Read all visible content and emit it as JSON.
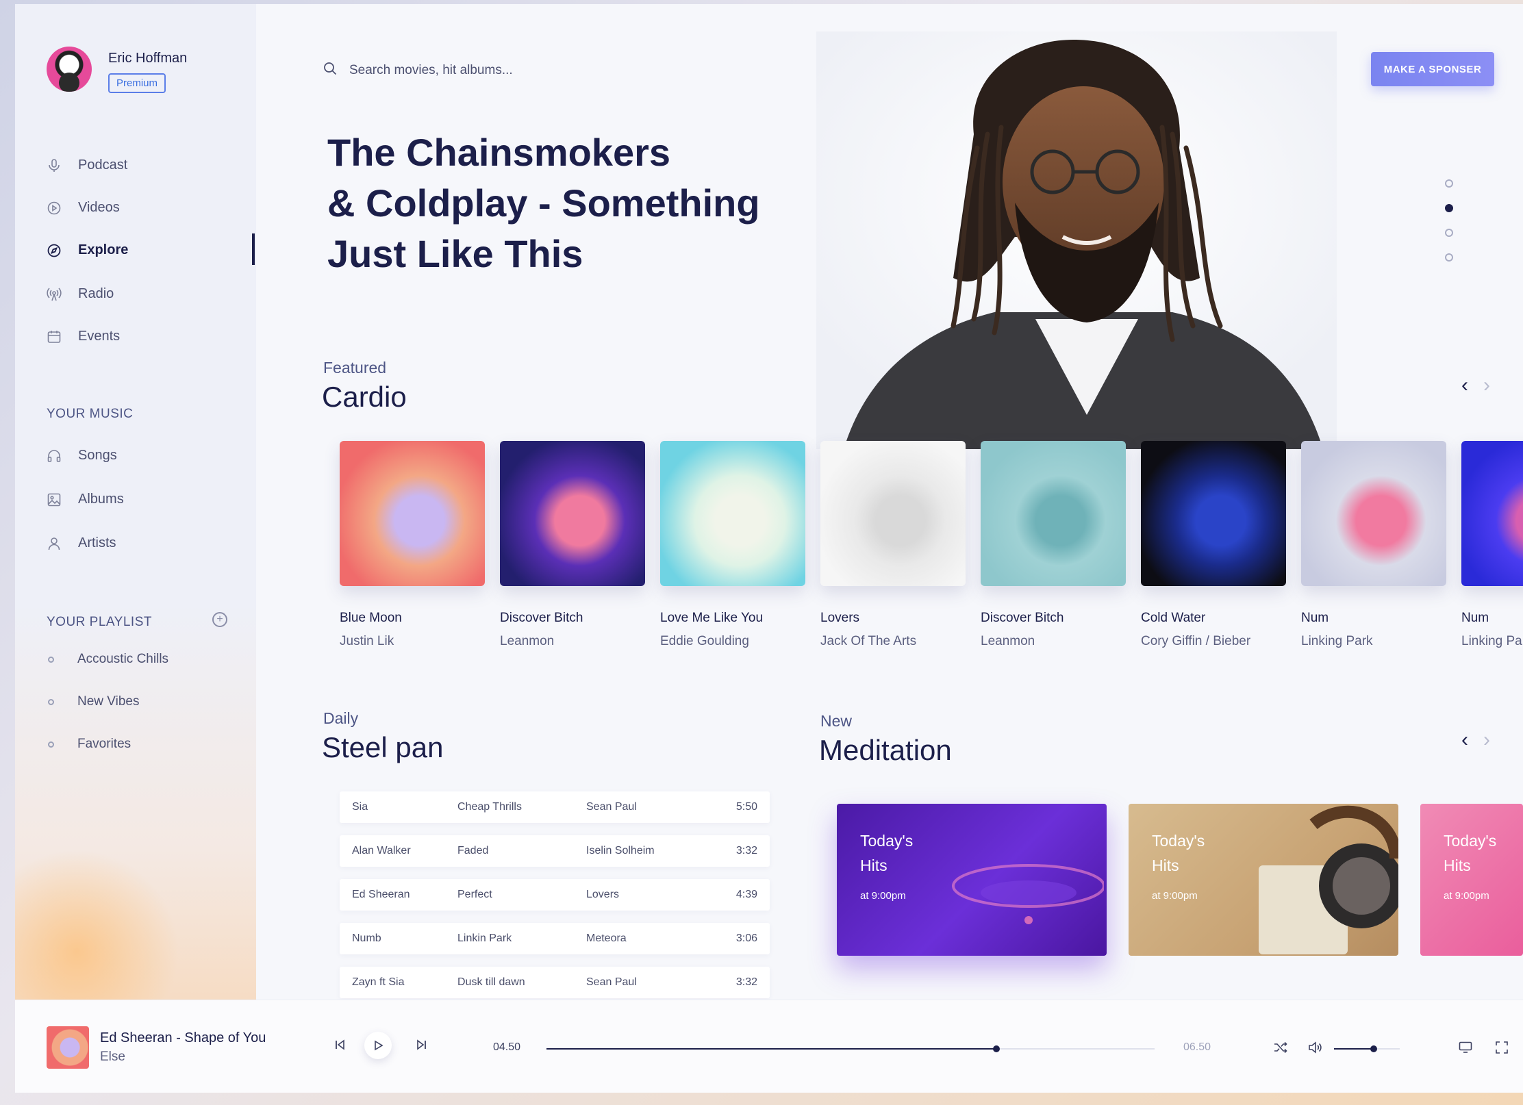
{
  "profile": {
    "name": "Eric Hoffman",
    "badge": "Premium"
  },
  "nav": [
    {
      "label": "Podcast",
      "icon": "mic-icon"
    },
    {
      "label": "Videos",
      "icon": "play-circle-icon"
    },
    {
      "label": "Explore",
      "icon": "compass-icon",
      "active": true
    },
    {
      "label": "Radio",
      "icon": "radio-icon"
    },
    {
      "label": "Events",
      "icon": "calendar-icon"
    }
  ],
  "your_music": {
    "heading": "YOUR MUSIC",
    "items": [
      {
        "label": "Songs",
        "icon": "headphones-icon"
      },
      {
        "label": "Albums",
        "icon": "image-icon"
      },
      {
        "label": "Artists",
        "icon": "user-icon"
      }
    ]
  },
  "your_playlist": {
    "heading": "YOUR PLAYLIST",
    "items": [
      "Accoustic Chills",
      "New Vibes",
      "Favorites"
    ]
  },
  "search": {
    "placeholder": "Search movies, hit albums..."
  },
  "sponsor_button": "MAKE A SPONSER",
  "hero": {
    "lines": [
      "The Chainsmokers",
      "& Coldplay - Something",
      "Just Like This"
    ],
    "slides": 4,
    "active_slide": 2
  },
  "featured": {
    "label": "Featured",
    "title": "Cardio",
    "albums": [
      {
        "title": "Blue Moon",
        "artist": "Justin Lik",
        "colors": [
          "#f06b6b",
          "#f3a785",
          "#c9b7f2"
        ]
      },
      {
        "title": "Discover Bitch",
        "artist": "Leanmon",
        "colors": [
          "#231f6e",
          "#5b2fb6",
          "#f07a9f"
        ]
      },
      {
        "title": "Love Me Like You",
        "artist": "Eddie Goulding",
        "colors": [
          "#6fd3e3",
          "#dff3e6",
          "#f1f4ea"
        ]
      },
      {
        "title": "Lovers",
        "artist": "Jack Of The Arts",
        "colors": [
          "#f6f6f6",
          "#e9e9e9",
          "#d9d9d9"
        ]
      },
      {
        "title": "Discover Bitch",
        "artist": "Leanmon",
        "colors": [
          "#8ec7cc",
          "#9fd1d4",
          "#6fb2b8"
        ]
      },
      {
        "title": "Cold Water",
        "artist": "Cory Giffin / Bieber",
        "colors": [
          "#0d0d14",
          "#1a2b8a",
          "#2a44c8"
        ]
      },
      {
        "title": "Num",
        "artist": "Linking Park",
        "colors": [
          "#c8cbe0",
          "#d9dbe9",
          "#f17aa0"
        ]
      },
      {
        "title": "Num",
        "artist": "Linking Park",
        "colors": [
          "#2a2ad8",
          "#4b3cf0",
          "#d85fb0"
        ]
      }
    ]
  },
  "daily": {
    "label": "Daily",
    "title": "Steel pan",
    "tracks": [
      [
        "Sia",
        "Cheap Thrills",
        "Sean Paul",
        "5:50"
      ],
      [
        "Alan Walker",
        "Faded",
        "Iselin Solheim",
        "3:32"
      ],
      [
        "Ed Sheeran",
        "Perfect",
        "Lovers",
        "4:39"
      ],
      [
        "Numb",
        "Linkin Park",
        "Meteora",
        "3:06"
      ],
      [
        "Zayn ft Sia",
        "Dusk till dawn",
        "Sean Paul",
        "3:32"
      ]
    ]
  },
  "meditation": {
    "label": "New",
    "title": "Meditation",
    "cards": [
      {
        "title": "Today's Hits",
        "time": "at 9:00pm"
      },
      {
        "title": "Today's Hits",
        "time": "at 9:00pm"
      },
      {
        "title": "Today's Hits",
        "time": "at 9:00pm"
      }
    ]
  },
  "player": {
    "title": "Ed Sheeran - Shape of You",
    "artist": "Else",
    "current": "04.50",
    "total": "06.50",
    "progress": 0.74,
    "volume": 0.6
  },
  "colors": {
    "accent": "#7a84f0",
    "ink": "#1c1f4a"
  }
}
